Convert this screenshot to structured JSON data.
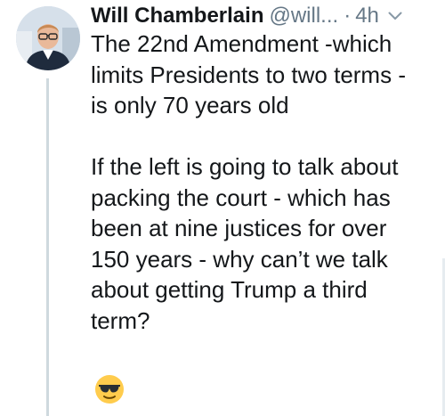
{
  "tweet": {
    "author": {
      "display_name": "Will Chamberlain",
      "handle": "@will...",
      "separator": "·",
      "time": "4h"
    },
    "paragraphs": [
      {
        "lines": [
          "The 22nd Amendment -which",
          "limits Presidents to two terms -",
          "is only 70 years old"
        ]
      },
      {
        "lines": [
          "If the left is going to talk about",
          "packing the court - which has",
          "been at nine justices for over",
          "150 years - why can’t we talk",
          "about getting Trump a third",
          "term?"
        ]
      }
    ],
    "emoji": "smiling-face-with-sunglasses"
  },
  "colors": {
    "text": "#14171a",
    "secondary": "#657786",
    "emoji_face": "#ffcc4d",
    "thread_line": "#cfd9de"
  }
}
